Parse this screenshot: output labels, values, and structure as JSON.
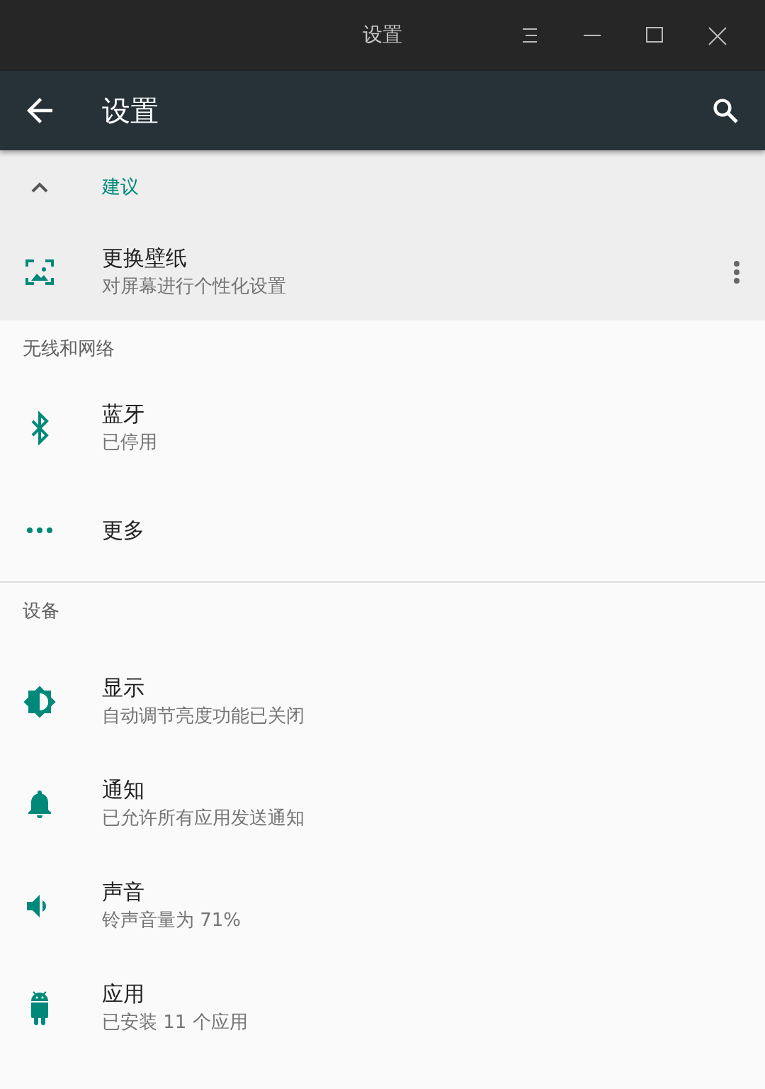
{
  "window": {
    "title": "设置"
  },
  "app_bar": {
    "title": "设置"
  },
  "suggestions": {
    "title": "建议",
    "expanded": true,
    "items": [
      {
        "kind": "wallpaper",
        "title": "更换壁纸",
        "summary": "对屏幕进行个性化设置"
      }
    ]
  },
  "categories": [
    {
      "title": "无线和网络",
      "items": [
        {
          "kind": "bluetooth",
          "title": "蓝牙",
          "summary": "已停用"
        },
        {
          "kind": "more",
          "title": "更多"
        }
      ]
    },
    {
      "title": "设备",
      "items": [
        {
          "kind": "display",
          "title": "显示",
          "summary": "自动调节亮度功能已关闭"
        },
        {
          "kind": "bell",
          "title": "通知",
          "summary": "已允许所有应用发送通知"
        },
        {
          "kind": "sound",
          "title": "声音",
          "summary": "铃声音量为 71%"
        },
        {
          "kind": "android",
          "title": "应用",
          "summary": "已安装 11 个应用"
        }
      ]
    }
  ]
}
